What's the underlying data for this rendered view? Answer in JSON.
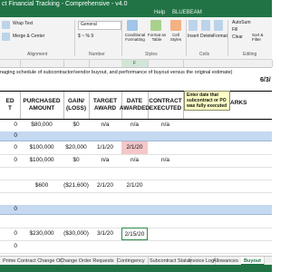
{
  "window": {
    "title": "ct Financial Tracking - Comprehensive - v4.0"
  },
  "menu": {
    "items": [
      "Help",
      "BLUEBEAM"
    ]
  },
  "ribbon": {
    "wrap_text": "Wrap Text",
    "merge_center": "Merge & Center",
    "number_format": "General",
    "currency": "$ ~ % 9",
    "conditional_formatting": "Conditional Formatting",
    "format_as_table": "Format as Table",
    "cell_styles": "Cell Styles",
    "insert": "Insert",
    "delete": "Delete",
    "format": "Format",
    "autosum": "AutoSum",
    "fill": "Fill",
    "clear": "Clear",
    "sort_filter": "Sort & Filter",
    "groups": {
      "alignment": "Alignment",
      "number": "Number",
      "styles": "Styles",
      "cells": "Cells",
      "editing": "Editing"
    }
  },
  "columns": [
    {
      "label": "",
      "selected": false
    },
    {
      "label": "",
      "selected": false
    },
    {
      "label": "",
      "selected": false
    },
    {
      "label": "",
      "selected": false
    },
    {
      "label": "F",
      "selected": true
    },
    {
      "label": "",
      "selected": false
    },
    {
      "label": "",
      "selected": false
    }
  ],
  "sheet": {
    "description": "naging schedule of subcontractor/vendor buyout, and performance of buyout versus the original estimate)",
    "date": "6/3/",
    "headers": {
      "budgeted": "ED\nT",
      "purchased": "PURCHASED\nAMOUNT",
      "gain_loss": "GAIN/\n(LOSS)",
      "target_award": "TARGET\nAWARD",
      "date_awarded": "DATE\nAWARDED",
      "contract_executed": "CONTRACT\nEXECUTED",
      "remarks": "ARKS"
    },
    "note": "Enter date that subcontract or PO was fully executed",
    "rows": [
      {
        "type": "data",
        "c1": "0",
        "c2": "$80,000",
        "c3": "$0",
        "c4": "n/a",
        "c5": "n/a",
        "c6": "n/a",
        "pink": false,
        "green": false
      },
      {
        "type": "blue",
        "c1": "0"
      },
      {
        "type": "data",
        "c1": "0",
        "c2": "$100,000",
        "c3": "$20,000",
        "c4": "1/1/20",
        "c5": "2/1/20",
        "c6": "",
        "pink": true,
        "green": false
      },
      {
        "type": "data",
        "c1": "0",
        "c2": "$100,000",
        "c3": "$0",
        "c4": "n/a",
        "c5": "n/a",
        "c6": "n/a",
        "pink": false,
        "green": false
      },
      {
        "type": "blank"
      },
      {
        "type": "data",
        "c1": "",
        "c2": "$600",
        "c3": "($21,600)",
        "c4": "2/1/20",
        "c5": "2/1/20",
        "c6": "",
        "pink": false,
        "green": false
      },
      {
        "type": "blank"
      },
      {
        "type": "blue",
        "c1": "0"
      },
      {
        "type": "blank"
      },
      {
        "type": "data",
        "c1": "0",
        "c2": "$230,000",
        "c3": "($30,000)",
        "c4": "3/1/20",
        "c5": "2/15/20",
        "c6": "",
        "pink": false,
        "green": true
      },
      {
        "type": "data",
        "c1": "0",
        "c2": "",
        "c3": "",
        "c4": "",
        "c5": "",
        "c6": "",
        "pink": false,
        "green": false
      }
    ]
  },
  "tabs": [
    {
      "label": "Prime Contract Change Orders",
      "active": false
    },
    {
      "label": "Change Order Requests",
      "active": false
    },
    {
      "label": "Contingency",
      "active": false
    },
    {
      "label": "Subcontract Status",
      "active": false
    },
    {
      "label": "Invoice Log",
      "active": false
    },
    {
      "label": "Allowances",
      "active": false
    },
    {
      "label": "Buyout",
      "active": true
    }
  ],
  "colors": {
    "excel_green": "#217346",
    "section_blue": "#c5d9f1",
    "pink_fill": "#f4c7c9",
    "note_yellow": "#ffffc6"
  }
}
